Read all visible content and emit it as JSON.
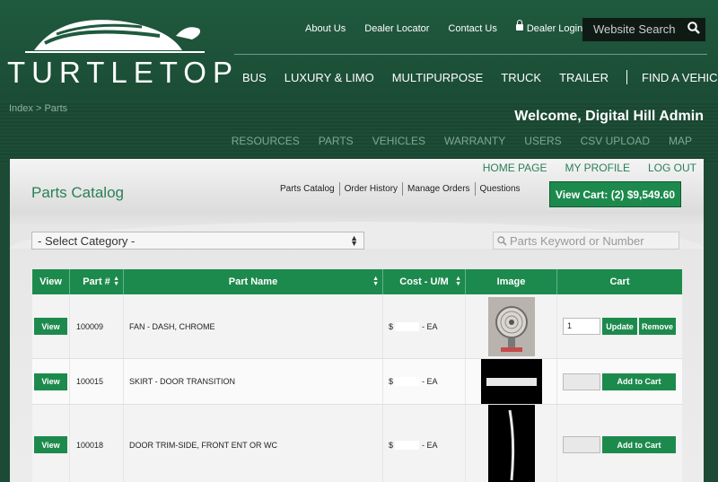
{
  "brand": {
    "logo_text": "TURTLETOP"
  },
  "top_links": {
    "about": "About Us",
    "dealer_locator": "Dealer Locator",
    "contact": "Contact Us",
    "dealer_login": "Dealer Login"
  },
  "search": {
    "placeholder": "Website Search"
  },
  "main_nav": [
    "BUS",
    "LUXURY & LIMO",
    "MULTIPURPOSE",
    "TRUCK",
    "TRAILER",
    "FIND A VEHICLE"
  ],
  "breadcrumb": "Index > Parts",
  "welcome": "Welcome, Digital Hill Admin",
  "admin_nav": [
    "RESOURCES",
    "PARTS",
    "VEHICLES",
    "WARRANTY",
    "USERS",
    "CSV UPLOAD",
    "MAP"
  ],
  "user_nav": [
    "HOME PAGE",
    "MY PROFILE",
    "LOG OUT"
  ],
  "panel": {
    "title": "Parts Catalog",
    "sub_nav": [
      "Parts Catalog",
      "Order History",
      "Manage Orders",
      "Questions"
    ],
    "cart_button": "View Cart: (2) $9,549.60",
    "category_select": "- Select Category -",
    "keyword_placeholder": "Parts Keyword or Number"
  },
  "table": {
    "headers": [
      "View",
      "Part #",
      "Part Name",
      "Cost - U/M",
      "Image",
      "Cart"
    ],
    "rows": [
      {
        "view": "View",
        "part": "100009",
        "name": "FAN - DASH, CHROME",
        "cost_prefix": "$",
        "um": "EA",
        "qty": "1",
        "btn1": "Update",
        "btn2": "Remove",
        "image": "fan"
      },
      {
        "view": "View",
        "part": "100015",
        "name": "SKIRT - DOOR TRANSITION",
        "cost_prefix": "$",
        "um": "EA",
        "qty": "",
        "btn1": "Add to Cart",
        "image": "skirt"
      },
      {
        "view": "View",
        "part": "100018",
        "name": "DOOR TRIM-SIDE, FRONT ENT OR WC",
        "cost_prefix": "$",
        "um": "EA",
        "qty": "",
        "btn1": "Add to Cart",
        "image": "trim"
      }
    ]
  },
  "colors": {
    "brand_green": "#1d8a4d",
    "header_green": "#1f5a3e",
    "link_green": "#2a8058"
  }
}
